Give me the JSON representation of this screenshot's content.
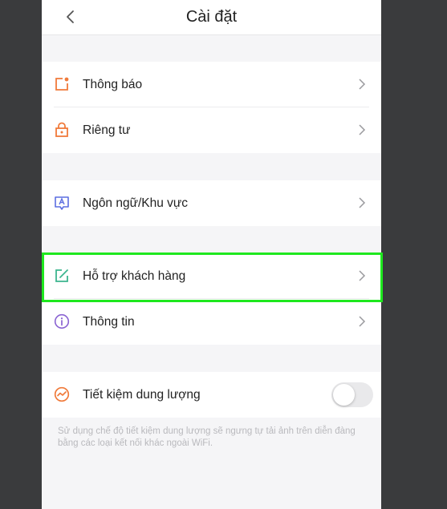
{
  "header": {
    "title": "Cài đặt"
  },
  "groups": [
    {
      "items": [
        {
          "label": "Thông báo",
          "icon": "notification-icon"
        },
        {
          "label": "Riêng tư",
          "icon": "lock-icon"
        }
      ]
    },
    {
      "items": [
        {
          "label": "Ngôn ngữ/Khu vực",
          "icon": "language-icon"
        }
      ]
    },
    {
      "items": [
        {
          "label": "Hỗ trợ khách hàng",
          "icon": "edit-icon"
        },
        {
          "label": "Thông tin",
          "icon": "info-icon"
        }
      ]
    },
    {
      "items": [
        {
          "label": "Tiết kiệm dung lượng",
          "icon": "data-saver-icon",
          "toggle": false
        }
      ]
    }
  ],
  "data_saver_note": "Sử dụng chế độ tiết kiệm dung lượng sẽ ngưng tự tải ảnh trên diễn đàng bằng các loại kết nối khác ngoài WiFi.",
  "colors": {
    "accent_orange": "#f07a3a",
    "language_blue": "#5b6ee1",
    "support_green": "#3cb58f",
    "info_purple": "#8a63d2",
    "highlight": "#1ee81e"
  }
}
